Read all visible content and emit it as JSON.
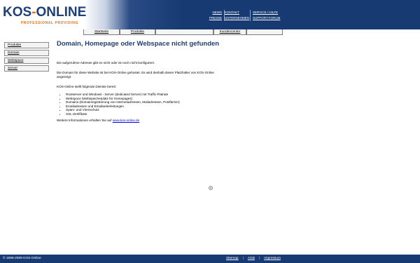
{
  "header": {
    "logo": {
      "text_main": "KOS",
      "text_dash": "-",
      "text_rest": "ONLINE",
      "tagline": "PROFESSIONAL PROVIDING"
    },
    "nav_col1": [
      "NEWS",
      "PRESSE"
    ],
    "nav_col2": [
      "KONTAKT",
      "UNTERNEHMEN"
    ],
    "nav_col3": [
      "SERVICE / HILFE",
      "SUPPORT-FORUM"
    ]
  },
  "tabs": [
    "Startseite",
    "Produkte",
    "",
    "Kundencenter",
    ""
  ],
  "sidebar": {
    "items": [
      "Produkte",
      "Domain",
      "Webspace",
      "Server"
    ]
  },
  "main": {
    "title": "Domain, Homepage oder Webspace nicht gefunden",
    "p1": "Die aufgerufene Adresse gibt es nicht oder ist noch nicht konfiguriert.",
    "p2": "Die Domain für diese Website ist bei KOS-Online gehostet. Es wird deshalb dieser Platzhalter von KOS-Online angezeigt.",
    "p3": "KOS-Online stellt folgende Dienste bereit:",
    "services": [
      "Rootserver und Windows - Server (dedicated Server) mit Traffic-Flatrate",
      "Webspace (Webspeicherplatz für Homepages)",
      "Domains (Domainregistrierung von Internetadressen, Mailadressen, Postfächer)",
      "Emailadressen und Emailweiterleitungen",
      "Spam- und Virenschutz",
      "SSL-Zertifikate"
    ],
    "more_prefix": "Weitere Informationen erhalten Sie auf ",
    "more_link": "www.kos-online.de"
  },
  "footer": {
    "copyright": "© 1996-2009 KOS-Online",
    "links": [
      "Sitemap",
      "AGB",
      "Impressum"
    ],
    "separator": "|"
  },
  "colors": {
    "brand_blue": "#173a73",
    "brand_orange": "#e2731c",
    "title_blue": "#1f3d73"
  }
}
